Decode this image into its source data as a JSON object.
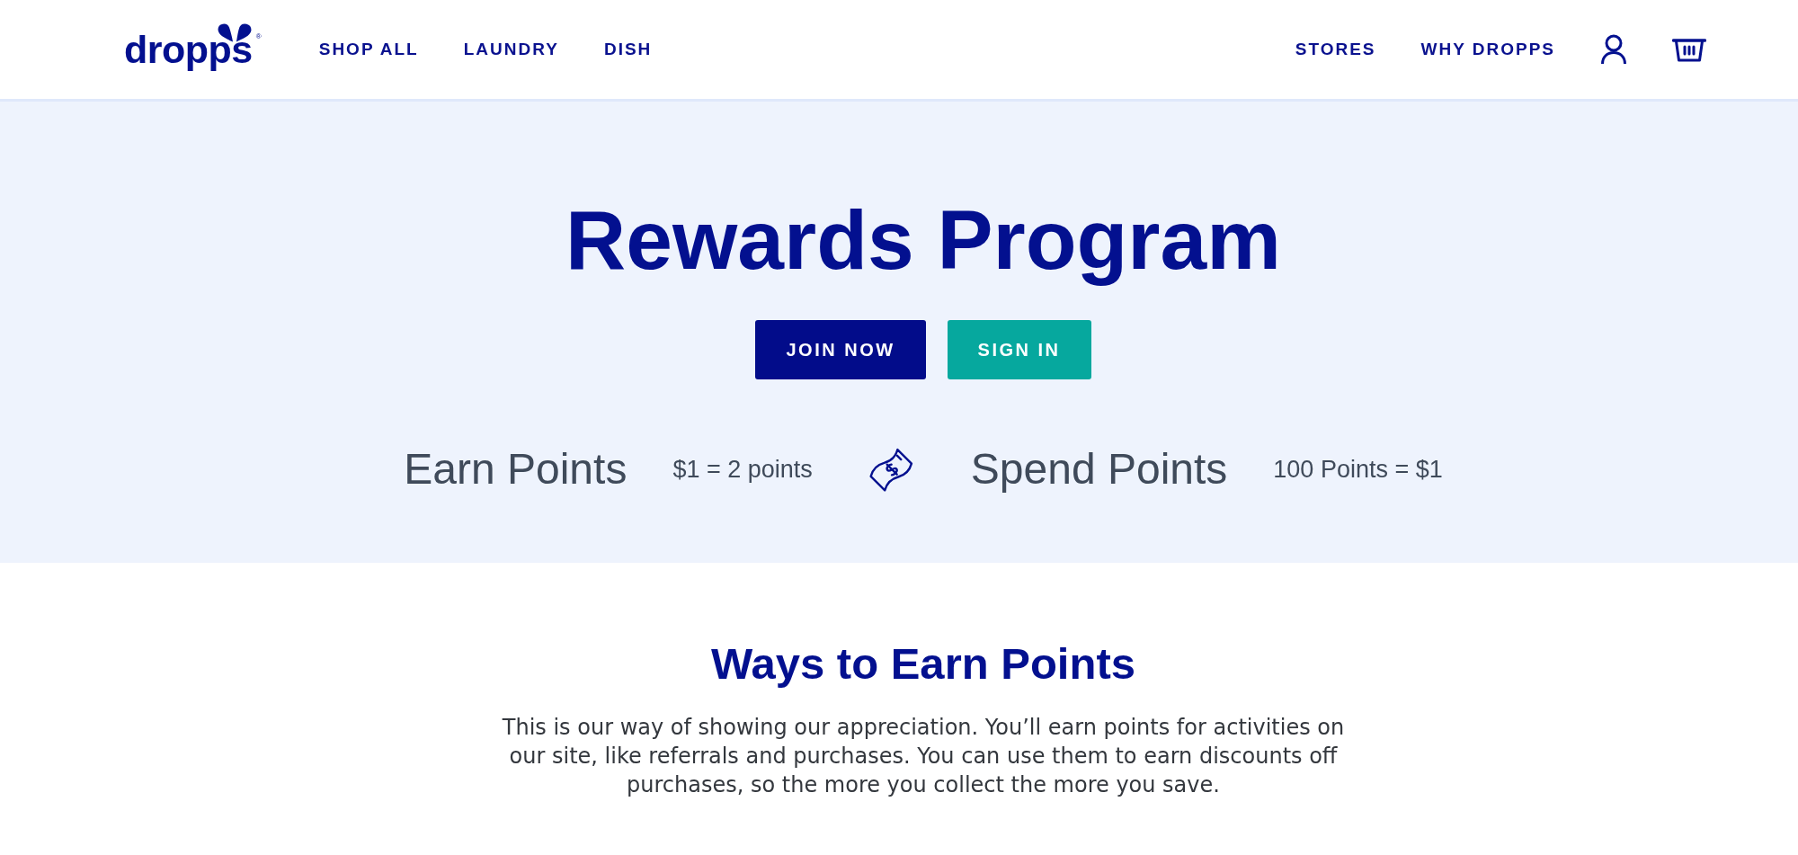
{
  "header": {
    "logo": {
      "text": "dropps",
      "registered_mark": "®"
    },
    "nav_left": [
      {
        "label": "SHOP ALL"
      },
      {
        "label": "LAUNDRY"
      },
      {
        "label": "DISH"
      }
    ],
    "nav_right": [
      {
        "label": "STORES"
      },
      {
        "label": "WHY DROPPS"
      }
    ]
  },
  "hero": {
    "title": "Rewards Program",
    "buttons": [
      {
        "label": "JOIN NOW",
        "kind": "primary"
      },
      {
        "label": "SIGN IN",
        "kind": "secondary"
      }
    ],
    "earn": {
      "title": "Earn Points",
      "rate": "$1 = 2 points"
    },
    "spend": {
      "title": "Spend Points",
      "rate": "100 Points = $1"
    }
  },
  "earn_section": {
    "heading": "Ways to Earn Points",
    "text": "This is our way of showing our appreciation. You’ll earn points for activities on our site, like referrals and purchases. You can use them to earn discounts off purchases, so the more you collect the more you save."
  }
}
